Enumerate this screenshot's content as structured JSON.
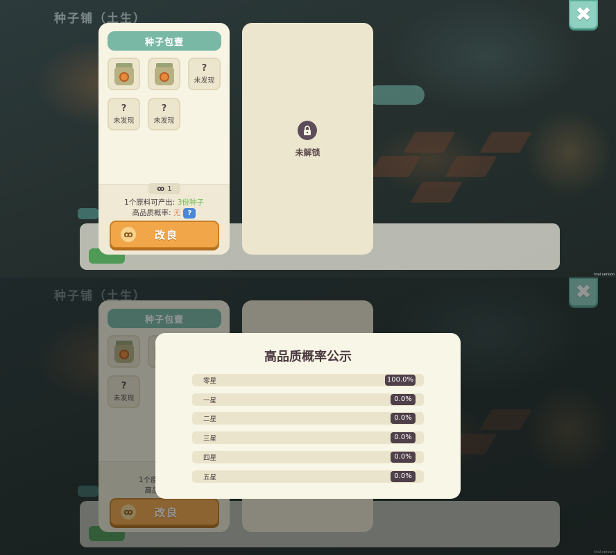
{
  "background": {
    "title": "种子铺（土生）",
    "tiny_text": "trial version"
  },
  "close_icon": "close-icon",
  "seed_panel": {
    "title": "种子包壹",
    "slots": [
      {
        "type": "seed-bag-icon"
      },
      {
        "type": "seed-bag-icon"
      },
      {
        "q": "?",
        "label": "未发现"
      },
      {
        "q": "?",
        "label": "未发现"
      },
      {
        "q": "?",
        "label": "未发现"
      }
    ],
    "count": "1",
    "yield_label": "1个原料可产出: ",
    "yield_value": "3份种子",
    "quality_label": "高品质概率: ",
    "quality_value": "无",
    "help_label": "?",
    "improve_label": "改良"
  },
  "locked_panel": {
    "label": "未解锁"
  },
  "probability_modal": {
    "title": "高品质概率公示",
    "rows": [
      {
        "name": "零星",
        "value": "100.0%"
      },
      {
        "name": "一星",
        "value": "0.0%"
      },
      {
        "name": "二星",
        "value": "0.0%"
      },
      {
        "name": "三星",
        "value": "0.0%"
      },
      {
        "name": "四星",
        "value": "0.0%"
      },
      {
        "name": "五星",
        "value": "0.0%"
      }
    ]
  }
}
